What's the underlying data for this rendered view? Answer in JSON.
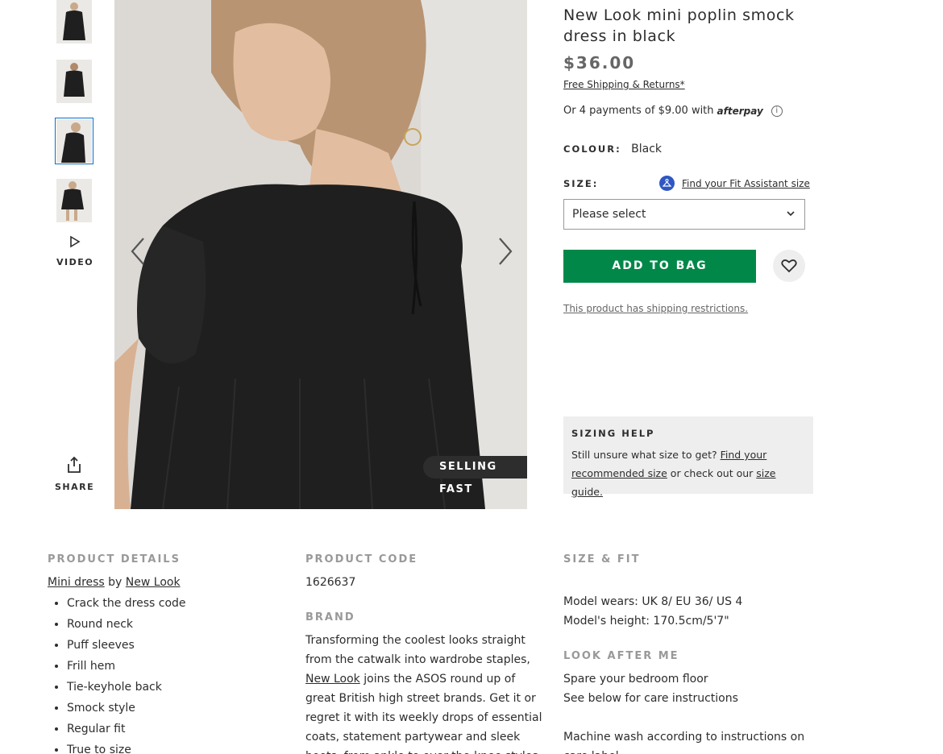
{
  "gallery": {
    "thumbnails": [
      "thumb-1",
      "thumb-2",
      "thumb-3",
      "thumb-4"
    ],
    "selected_index": 2,
    "video_label": "VIDEO",
    "share_label": "SHARE",
    "badge": "SELLING FAST"
  },
  "product": {
    "title": "New Look mini poplin smock dress in black",
    "price": "$36.00",
    "shipping_link": "Free Shipping & Returns*",
    "afterpay_prefix": "Or 4 payments of $9.00 with",
    "afterpay_logo": "afterpay",
    "colour_label": "COLOUR:",
    "colour_value": "Black",
    "size_label": "SIZE:",
    "fit_assistant": "Find your Fit Assistant size",
    "size_placeholder": "Please select",
    "add_to_bag": "ADD TO BAG",
    "shipping_restrictions": "This product has shipping restrictions."
  },
  "sizing_help": {
    "heading": "SIZING HELP",
    "text_1": "Still unsure what size to get?",
    "link_1": "Find your recommended size",
    "text_2": "or check out our",
    "link_2": "size guide."
  },
  "details": {
    "heading": "PRODUCT DETAILS",
    "category_link": "Mini dress",
    "by": "by",
    "brand_link": "New Look",
    "features": [
      "Crack the dress code",
      "Round neck",
      "Puff sleeves",
      "Frill hem",
      "Tie-keyhole back",
      "Smock style",
      "Regular fit",
      "True to size"
    ]
  },
  "product_code": {
    "heading": "PRODUCT CODE",
    "value": "1626637"
  },
  "brand": {
    "heading": "BRAND",
    "text_1": "Transforming the coolest looks straight from the catwalk into wardrobe staples,",
    "link": "New Look",
    "text_2": "joins the ASOS round up of great British high street brands. Get it or regret it with its weekly drops of essential coats, statement partywear and sleek boots, from ankle to over-the-knee styles."
  },
  "size_fit": {
    "heading": "SIZE & FIT",
    "model_wears": "Model wears: UK 8/ EU 36/ US 4",
    "model_height": "Model's height: 170.5cm/5'7\""
  },
  "care": {
    "heading": "LOOK AFTER ME",
    "line_1": "Spare your bedroom floor",
    "line_2": "See below for care instructions",
    "line_3": "Machine wash according to instructions on care label"
  },
  "colors": {
    "accent_green": "#018849",
    "dress": "#1f1f1f",
    "selected_outline": "#0770cf"
  }
}
